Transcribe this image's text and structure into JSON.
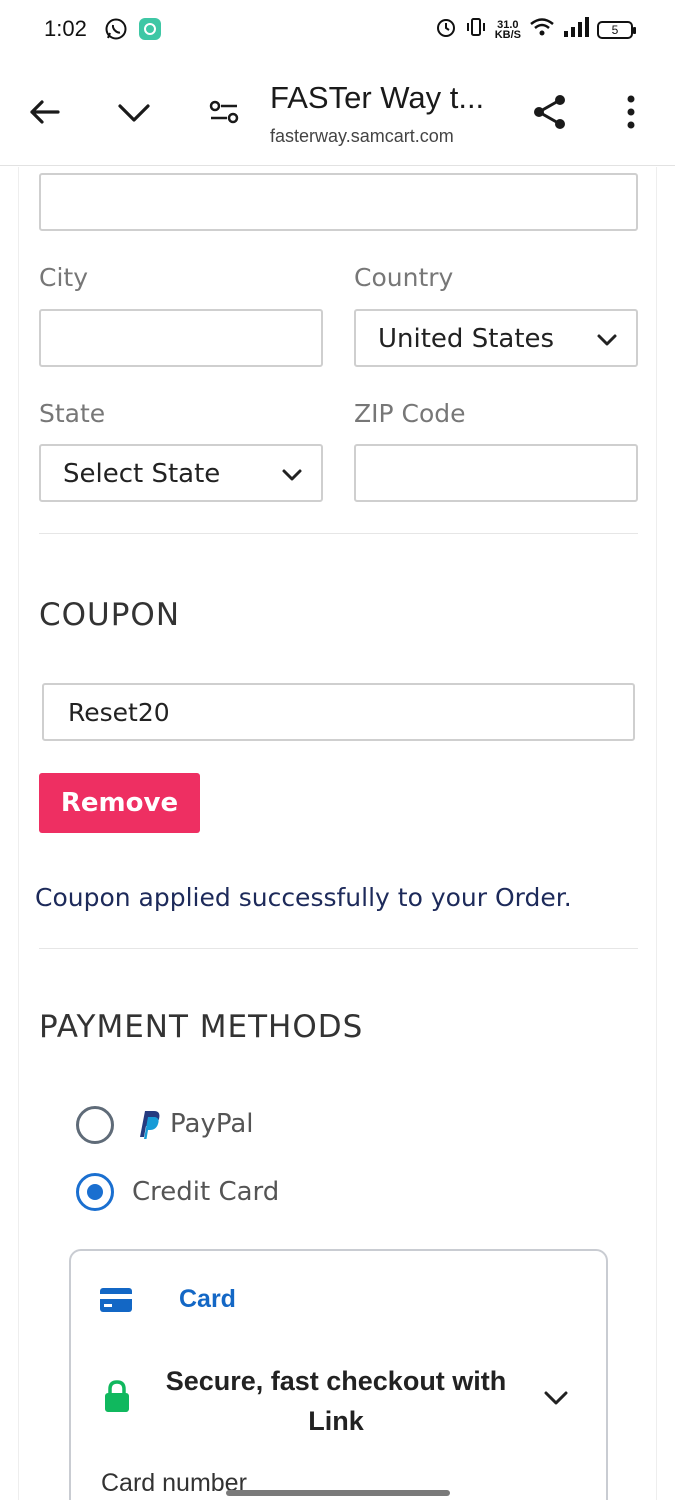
{
  "status_bar": {
    "time": "1:02",
    "net_speed_value": "31.0",
    "net_speed_unit": "KB/S",
    "battery": "5"
  },
  "browser": {
    "title": "FASTer Way t...",
    "url": "fasterway.samcart.com"
  },
  "form": {
    "city_label": "City",
    "city_value": "",
    "country_label": "Country",
    "country_value": "United States",
    "state_label": "State",
    "state_value": "Select State",
    "zip_label": "ZIP Code",
    "zip_value": ""
  },
  "coupon": {
    "title": "COUPON",
    "code": "Reset20",
    "remove_label": "Remove",
    "message": "Coupon applied successfully to your Order.",
    "remove_color": "#ee2f62"
  },
  "payment": {
    "title": "PAYMENT METHODS",
    "options": [
      {
        "label": "PayPal",
        "selected": false
      },
      {
        "label": "Credit Card",
        "selected": true
      }
    ],
    "card_tab_label": "Card",
    "link_text": "Secure, fast checkout with Link",
    "card_number_label": "Card number",
    "accent_color": "#1a6fd0"
  }
}
